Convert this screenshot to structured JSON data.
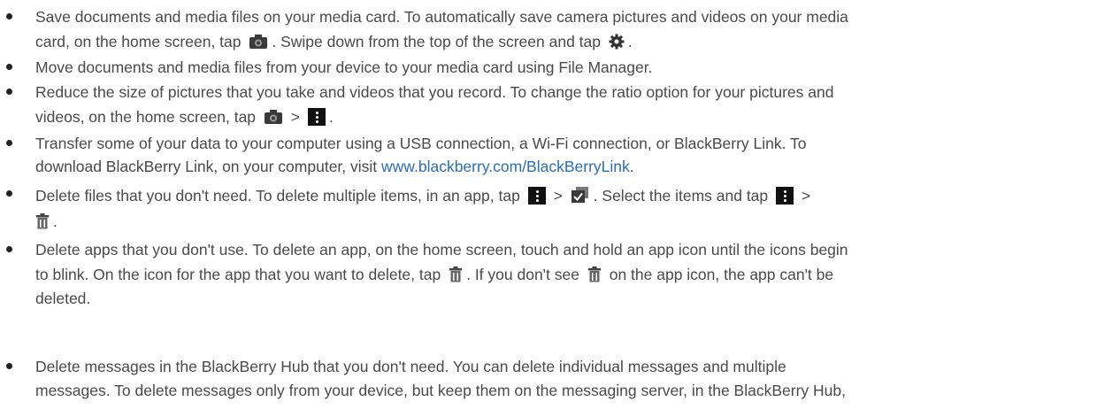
{
  "colors": {
    "text": "#4a4a4a",
    "link": "#2c6fb5",
    "bullet": "#222222",
    "icon": "#111111"
  },
  "tips": [
    {
      "line1": {
        "a": "Save documents and media files on your media card. To automatically save camera pictures and videos on your media"
      },
      "line2": {
        "a": "card, on the home screen, tap",
        "b": ". Swipe down from the top of the screen and tap",
        "c": "."
      }
    },
    {
      "line1": {
        "a": "Move documents and media files from your device to your media card using File Manager."
      }
    },
    {
      "line1": {
        "a": "Reduce the size of pictures that you take and videos that you record. To change the ratio option for your pictures and"
      },
      "line2": {
        "a": "videos, on the home screen, tap",
        "b": ">",
        "c": "."
      }
    },
    {
      "line1": {
        "a": "Transfer some of your data to your computer using a USB connection, a Wi-Fi connection, or BlackBerry Link. To"
      },
      "line2": {
        "a": "download BlackBerry Link, on your computer, visit",
        "link": "www.blackberry.com/BlackBerryLink",
        "b": "."
      }
    },
    {
      "line1": {
        "a": "Delete files that you don't need. To delete multiple items, in an app, tap",
        "b": ">",
        "c": ". Select the items and tap",
        "d": ">"
      },
      "line2": {
        "a": "."
      }
    },
    {
      "line1": {
        "a": "Delete apps that you don't use. To delete an app, on the home screen, touch and hold an app icon until the icons begin"
      },
      "line2": {
        "a": "to blink. On the icon for the app that you want to delete, tap",
        "b": ". If you don't see",
        "c": "on the app icon, the app can't be"
      },
      "line3": {
        "a": "deleted."
      }
    },
    {
      "line1": {
        "a": "Delete messages in the BlackBerry Hub that you don't need. You can delete individual messages and multiple"
      },
      "line2": {
        "a": "messages. To delete messages only from your device, but keep them on the messaging server, in the BlackBerry Hub,"
      }
    }
  ],
  "icons": {
    "camera": "camera-icon",
    "settings": "gear-icon",
    "menu": "overflow-menu-icon",
    "select": "select-items-icon",
    "delete": "trash-icon"
  }
}
